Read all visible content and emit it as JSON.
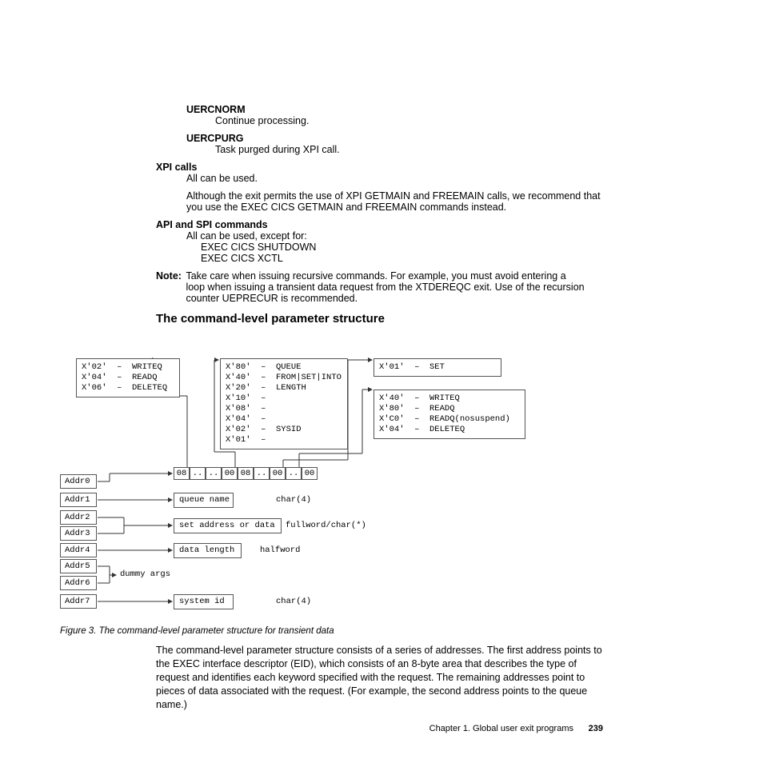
{
  "defs": {
    "uercnorm_term": "UERCNORM",
    "uercnorm_def": "Continue processing.",
    "uercpurg_term": "UERCPURG",
    "uercpurg_def": "Task purged during XPI call."
  },
  "xpi": {
    "label": "XPI calls",
    "body": "All can be used.",
    "body2": "Although the exit permits the use of XPI GETMAIN and FREEMAIN calls, we recommend that you use the EXEC CICS GETMAIN and FREEMAIN commands instead."
  },
  "api": {
    "label": "API and SPI commands",
    "body": "All can be used, except for:",
    "cmd1": "EXEC CICS SHUTDOWN",
    "cmd2": "EXEC CICS XCTL"
  },
  "note": {
    "label": "Note:",
    "body": "Take care when issuing recursive commands. For example, you must avoid entering a loop when issuing a transient data request from the XTDEREQC exit. Use of the recursion counter UEPRECUR is recommended."
  },
  "section_title": "The command-level parameter structure",
  "diagram": {
    "box1": "X'02'  –  WRITEQ\nX'04'  –  READQ\nX'06'  –  DELETEQ",
    "box2": "X'80'  –  QUEUE\nX'40'  –  FROM|SET|INTO\nX'20'  –  LENGTH\nX'10'  –\nX'08'  –\nX'04'  –\nX'02'  –  SYSID\nX'01'  –",
    "box3": "X'01'  –  SET",
    "box4": "X'40'  –  WRITEQ\nX'80'  –  READQ\nX'C0'  –  READQ(nosuspend)\nX'04'  –  DELETEQ",
    "addr": [
      "Addr0",
      "Addr1",
      "Addr2",
      "Addr3",
      "Addr4",
      "Addr5",
      "Addr6",
      "Addr7"
    ],
    "hbytes": [
      "08",
      "..",
      "..",
      "00",
      "08",
      "..",
      "00",
      "..",
      "00"
    ],
    "qname": "queue name",
    "qname_type": "char(4)",
    "setaddr": "set address or data",
    "setaddr_type": "fullword/char(*)",
    "datalen": "data length",
    "datalen_type": "halfword",
    "dummy": "dummy args",
    "sysid": "system id",
    "sysid_type": "char(4)"
  },
  "caption": "Figure 3. The command-level parameter structure for transient data",
  "para": "The command-level parameter structure consists of a series of addresses. The first address points to the EXEC interface descriptor (EID), which consists of an 8-byte area that describes the type of request and identifies each keyword specified with the request. The remaining addresses point to pieces of data associated with the request. (For example, the second address points to the queue name.)",
  "footer": {
    "chap": "Chapter 1. Global user exit programs",
    "pg": "239"
  }
}
